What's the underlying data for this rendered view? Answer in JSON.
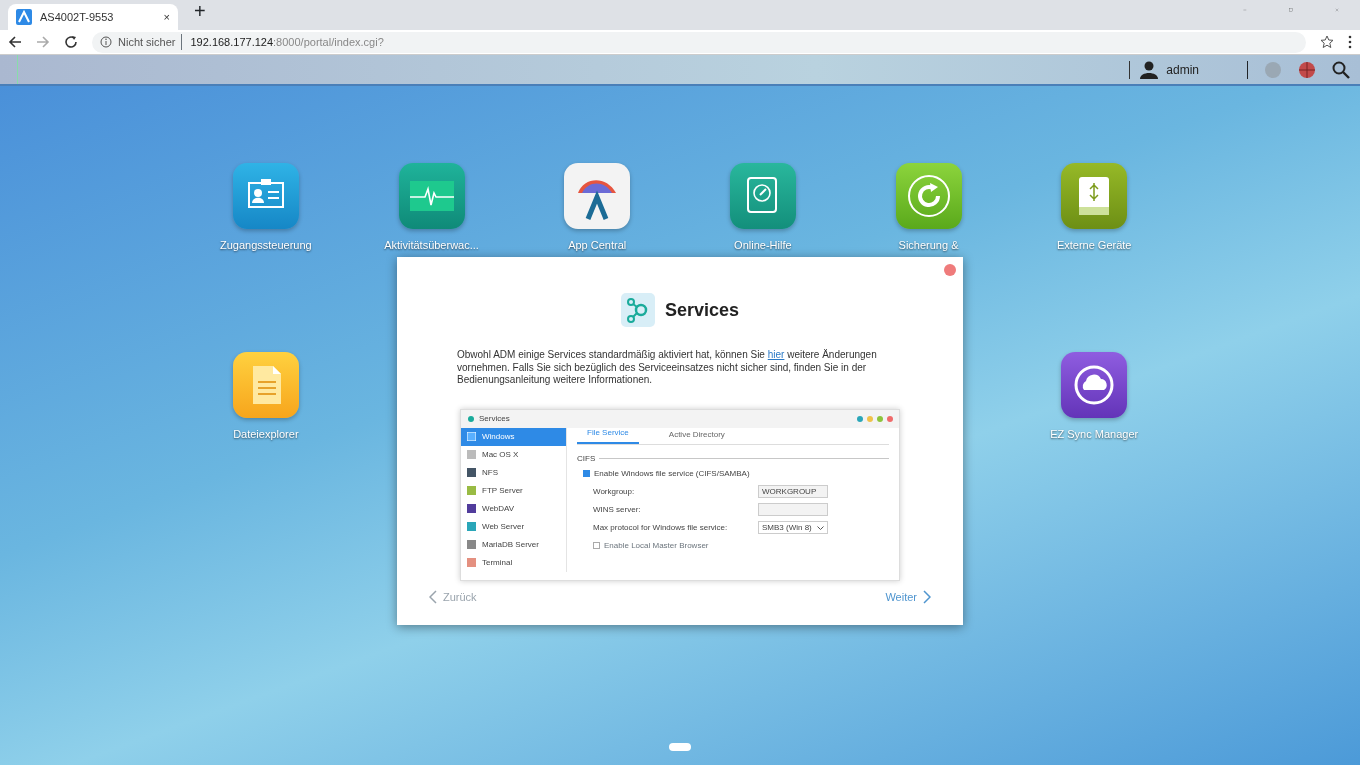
{
  "browser": {
    "tab": {
      "title": "AS4002T-9553",
      "close": "×"
    },
    "new_tab": "+",
    "address": {
      "security": "Nicht sicher",
      "host": "192.168.177.124",
      "path": ":8000/portal/index.cgi?"
    }
  },
  "topbar": {
    "user": "admin"
  },
  "desktop": {
    "rows": [
      [
        {
          "kind": "access",
          "label": "Zugangssteuerung"
        },
        {
          "kind": "monitor",
          "label": "Aktivitätsüberwac..."
        },
        {
          "kind": "appcentral",
          "label": "App Central"
        },
        {
          "kind": "help",
          "label": "Online-Hilfe"
        },
        {
          "kind": "backup",
          "label": "Sicherung &"
        },
        {
          "kind": "external",
          "label": "Externe Geräte"
        }
      ],
      [
        {
          "kind": "files",
          "label": "Dateiexplorer"
        },
        "",
        "",
        "",
        "",
        {
          "kind": "ezsync",
          "label": "EZ Sync Manager"
        }
      ]
    ],
    "pages": [
      {
        "selected": true
      }
    ]
  },
  "dialog": {
    "title": "Services",
    "text_before": "Obwohl ADM einige Services standardmäßig aktiviert hat, können Sie ",
    "link": "hier",
    "text_after": " weitere Änderungen vornehmen. Falls Sie sich bezüglich des Serviceeinsatzes nicht sicher sind, finden Sie in der Bedienungsanleitung weitere Informationen.",
    "preview": {
      "title": "Services",
      "sidebar": [
        {
          "kind": "windows",
          "label": "Windows",
          "selected": true
        },
        {
          "kind": "mac",
          "label": "Mac OS X",
          "selected": false
        },
        {
          "kind": "nfs",
          "label": "NFS",
          "selected": false
        },
        {
          "kind": "ftp",
          "label": "FTP Server",
          "selected": false
        },
        {
          "kind": "webdav",
          "label": "WebDAV",
          "selected": false
        },
        {
          "kind": "web",
          "label": "Web Server",
          "selected": false
        },
        {
          "kind": "maria",
          "label": "MariaDB Server",
          "selected": false
        },
        {
          "kind": "terminal",
          "label": "Terminal",
          "selected": false
        }
      ],
      "tabs": [
        {
          "label": "File Service",
          "selected": true
        },
        {
          "label": "Active Directory",
          "selected": false
        }
      ],
      "section": "CIFS",
      "enable": {
        "label": "Enable Windows file service (CIFS/SAMBA)",
        "checked": true
      },
      "fields": [
        {
          "kind": "input",
          "label": "Workgroup:",
          "value": "WORKGROUP"
        },
        {
          "kind": "input",
          "label": "WINS server:"
        },
        {
          "kind": "select",
          "label": "Max protocol for Windows file service:",
          "value": "SMB3 (Win 8)"
        }
      ],
      "local_master": {
        "label": "Enable Local Master Browser",
        "checked": false
      }
    },
    "back": {
      "label": "Zurück",
      "disabled": true
    },
    "next": {
      "label": "Weiter",
      "disabled": false
    }
  }
}
